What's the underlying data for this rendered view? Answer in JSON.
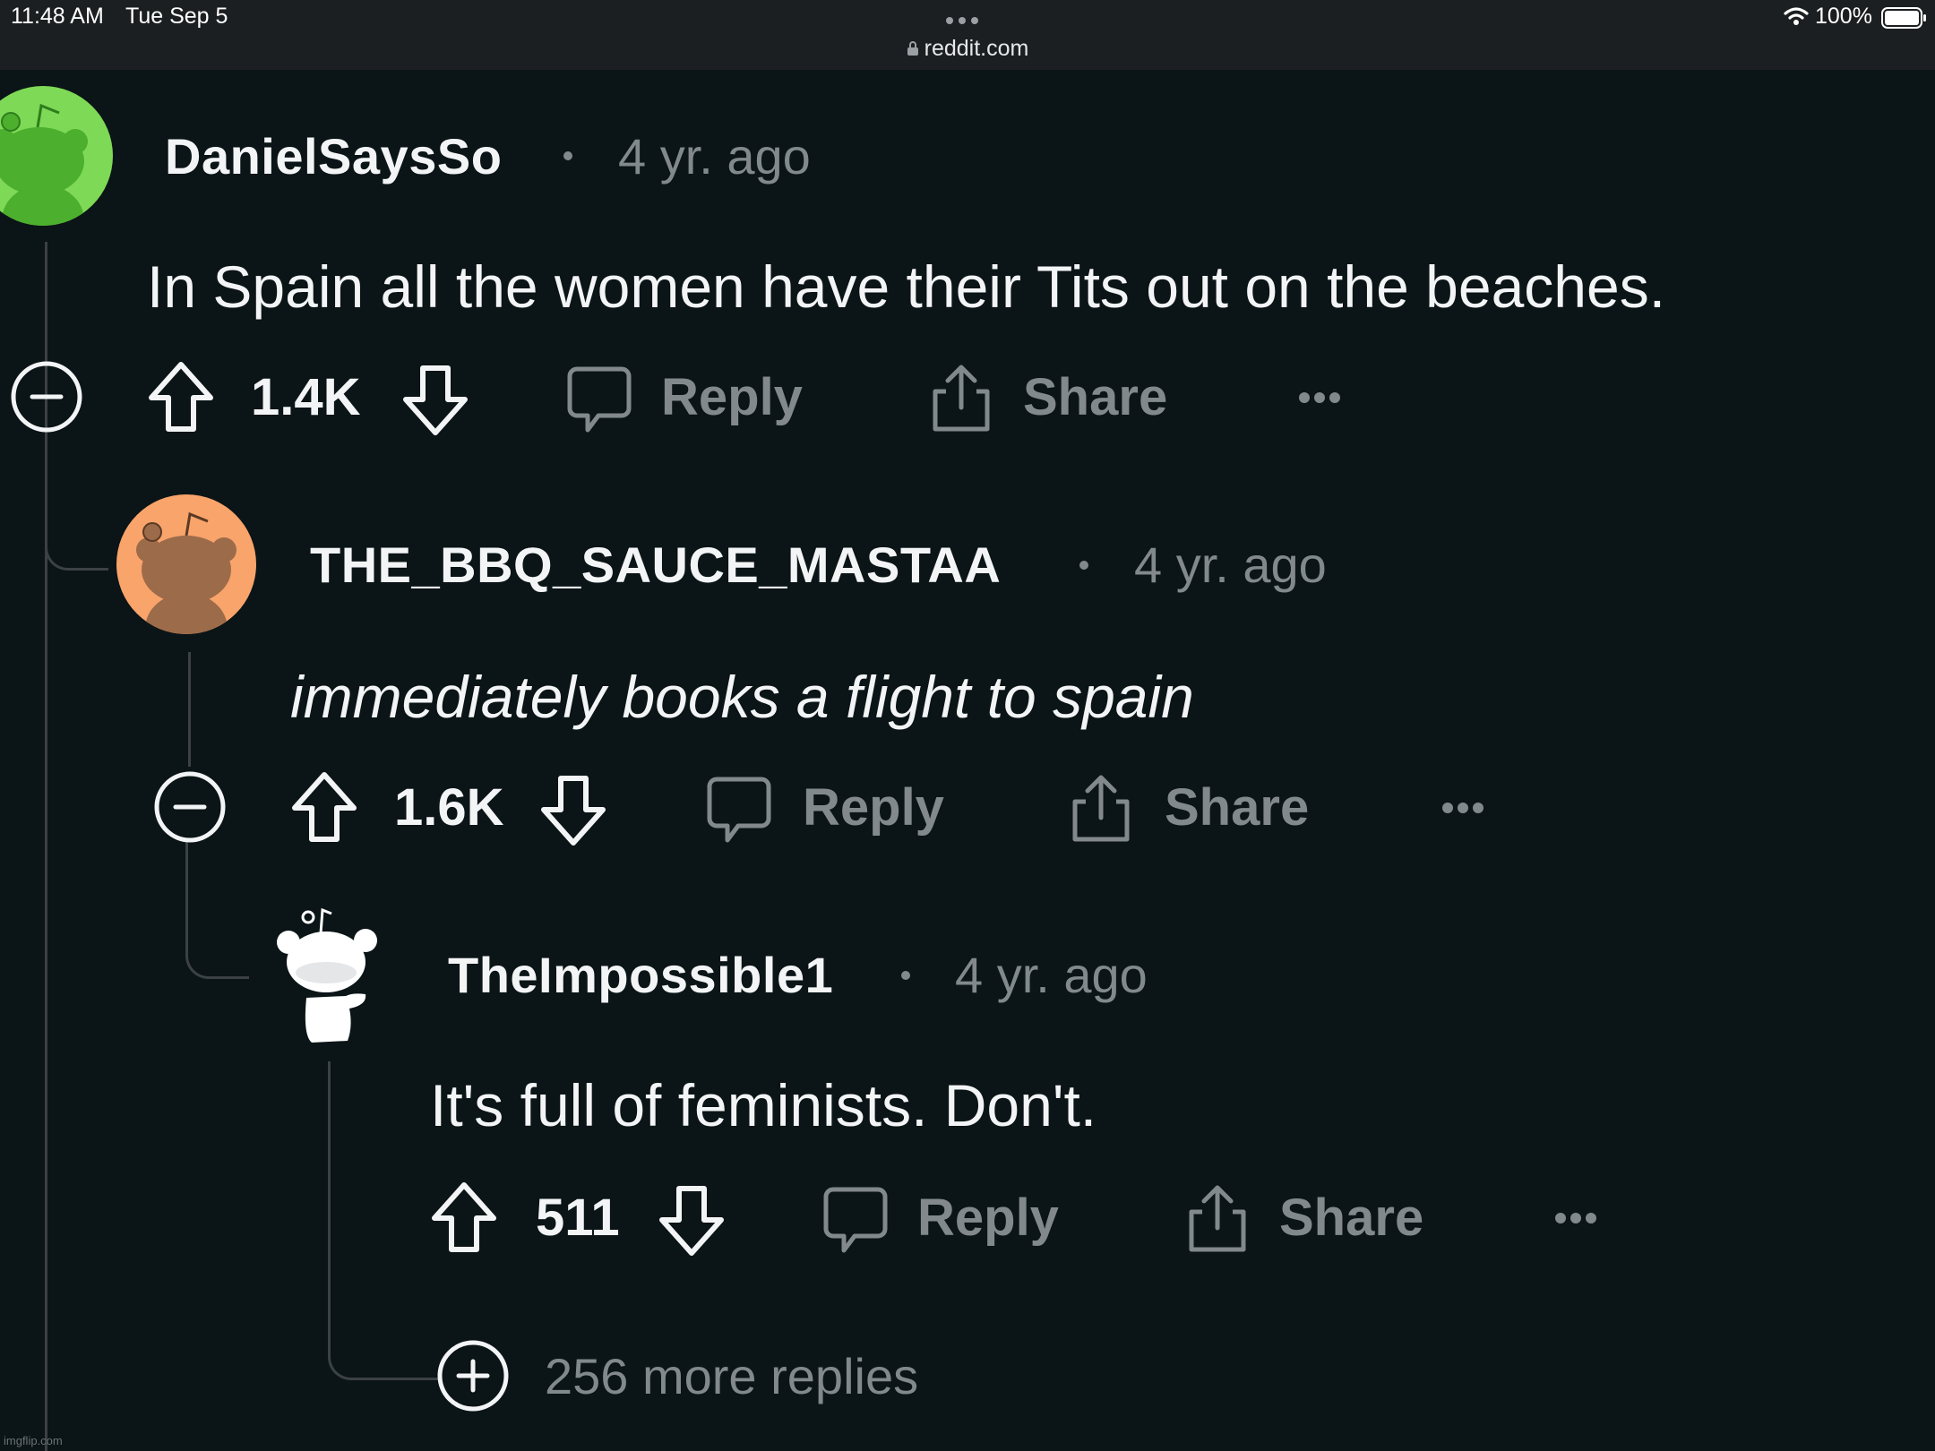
{
  "status_bar": {
    "time": "11:48 AM",
    "date": "Tue Sep 5",
    "battery": "100%",
    "url": "reddit.com"
  },
  "comments": [
    {
      "username": "DanielSaysSo",
      "time": "4 yr. ago",
      "body": "In Spain all the women have their Tits out on the beaches.",
      "votes": "1.4K",
      "reply_label": "Reply",
      "share_label": "Share",
      "avatar_color": "#7ed957"
    },
    {
      "username": "THE_BBQ_SAUCE_MASTAA",
      "time": "4 yr. ago",
      "body": "immediately books a flight to spain",
      "votes": "1.6K",
      "reply_label": "Reply",
      "share_label": "Share",
      "avatar_color": "#f9a46b"
    },
    {
      "username": "TheImpossible1",
      "time": "4 yr. ago",
      "body": "It's full of feminists. Don't.",
      "votes": "511",
      "reply_label": "Reply",
      "share_label": "Share",
      "avatar_color": "#ffffff"
    }
  ],
  "more_replies": "256 more replies",
  "watermark": "imgflip.com"
}
